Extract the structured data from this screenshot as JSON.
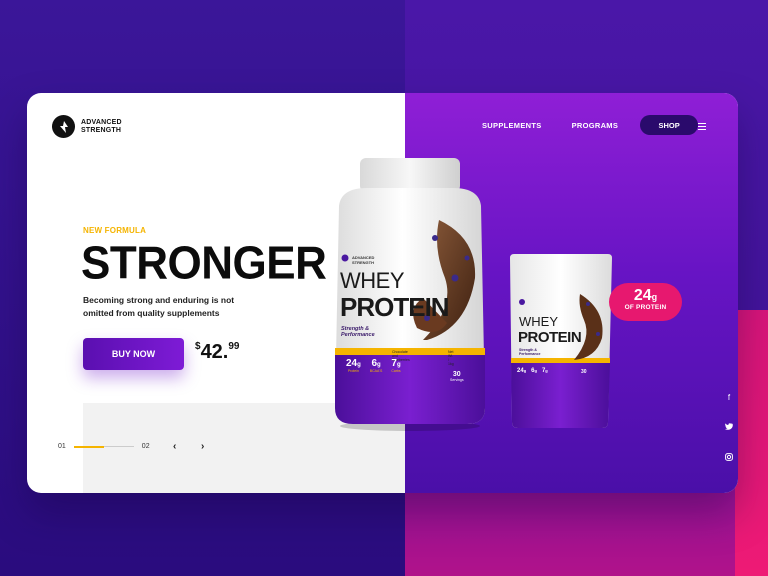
{
  "brand": {
    "name_line1": "ADVANCED",
    "name_line2": "STRENGTH"
  },
  "nav": {
    "links": [
      "SUPPLEMENTS",
      "PROGRAMS"
    ],
    "shop_label": "SHOP"
  },
  "hero": {
    "eyebrow": "NEW FORMULA",
    "headline": "STRONGER",
    "subtitle": "Becoming strong and enduring is not omitted from quality supplements",
    "buy_label": "BUY NOW",
    "price": {
      "currency": "$",
      "main": "42.",
      "cents": "99"
    }
  },
  "slider": {
    "current": "01",
    "next": "02",
    "progress": 0.5
  },
  "badge": {
    "value": "24",
    "unit": "g",
    "label": "OF PROTEIN"
  },
  "product_jar": {
    "brand": "ADVANCED STRENGTH",
    "line1": "WHEY",
    "line2": "PROTEIN",
    "tagline": "Strength & Performance",
    "flavor": "Chocolate and Blueberries",
    "net": "Net Wt. / 1kg",
    "stats": [
      {
        "value": "24",
        "unit": "g",
        "label": "Protein"
      },
      {
        "value": "6",
        "unit": "g",
        "label": "BCAA'S"
      },
      {
        "value": "7",
        "unit": "g",
        "label": "Carbs"
      }
    ],
    "servings": "30",
    "servings_label": "Servings"
  },
  "product_pouch": {
    "line1": "WHEY",
    "line2": "PROTEIN",
    "tagline": "Strength & Performance",
    "stats": [
      {
        "value": "24",
        "unit": "g"
      },
      {
        "value": "6",
        "unit": "g"
      },
      {
        "value": "7",
        "unit": "g"
      }
    ],
    "servings": "30"
  },
  "colors": {
    "accent_purple": "#7e1bd6",
    "accent_yellow": "#f5b400",
    "accent_pink": "#e7186f",
    "dark_navy": "#2a0a6c"
  },
  "icons": [
    "facebook-icon",
    "twitter-icon",
    "instagram-icon",
    "menu-icon"
  ]
}
